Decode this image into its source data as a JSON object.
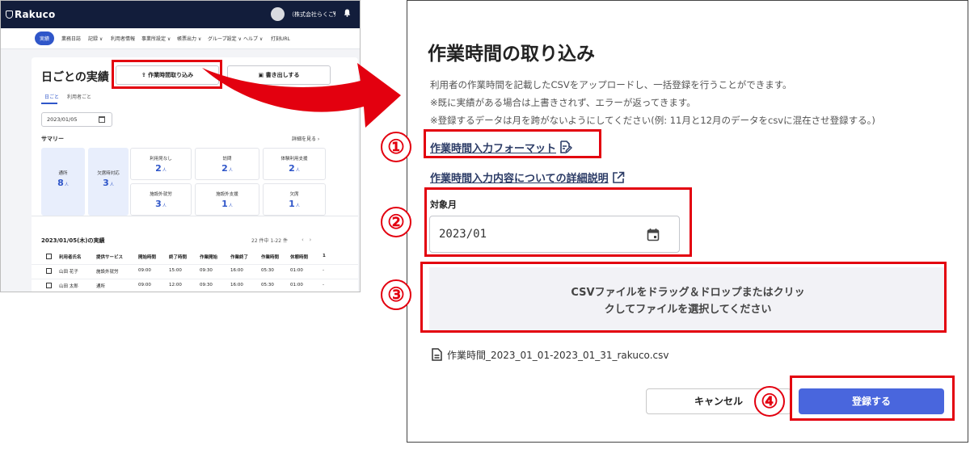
{
  "app": {
    "logo": "Rakuco",
    "company": "（株式会社らくこ）",
    "nav": [
      "実績",
      "業務日誌",
      "記録",
      "利用者情報",
      "事業所設定",
      "帳票出力",
      "グループ設定",
      "ヘルプ",
      "打刻URL"
    ],
    "page_title": "日ごとの実績",
    "import_button": "作業時間取り込み",
    "export_button": "書き出しする",
    "tabs": [
      "日ごと",
      "利用者ごと"
    ],
    "date": "2023/01/05",
    "summary_label": "サマリー",
    "details_link": "詳細を見る",
    "stats": [
      {
        "label": "通所",
        "value": "8",
        "unit": "人"
      },
      {
        "label": "欠席時対応",
        "value": "3",
        "unit": "人"
      },
      {
        "label": "利用見なし",
        "value": "2",
        "unit": "人"
      },
      {
        "label": "訪問",
        "value": "2",
        "unit": "人"
      },
      {
        "label": "体験利用支援",
        "value": "2",
        "unit": "人"
      },
      {
        "label": "施設外就労",
        "value": "3",
        "unit": "人"
      },
      {
        "label": "施設外支援",
        "value": "1",
        "unit": "人"
      },
      {
        "label": "欠席",
        "value": "1",
        "unit": "人"
      }
    ],
    "table_title": "2023/01/05(木)の実績",
    "pager": "22 件中 1-22 件",
    "columns": [
      "利用者氏名",
      "提供サービス",
      "開始時間",
      "終了時間",
      "作業開始",
      "作業終了",
      "作業時間",
      "休憩時間",
      "1"
    ],
    "rows": [
      [
        "山田 花子",
        "施設外就労",
        "09:00",
        "15:00",
        "09:30",
        "16:00",
        "05:30",
        "01:00",
        "-"
      ],
      [
        "山田 太郎",
        "通所",
        "09:00",
        "12:00",
        "09:30",
        "16:00",
        "05:30",
        "01:00",
        "-"
      ]
    ]
  },
  "dialog": {
    "title": "作業時間の取り込み",
    "description": [
      "利用者の作業時間を記載したCSVをアップロードし、一括登録を行うことができます。",
      "※既に実績がある場合は上書きされず、エラーが返ってきます。",
      "※登録するデータは月を跨がないようにしてください(例: 11月と12月のデータをcsvに混在させ登録する。)"
    ],
    "format_link": "作業時間入力フォーマット",
    "detail_link": "作業時間入力内容についての詳細説明",
    "month_label": "対象月",
    "month_value": "2023/01",
    "drop_text_1": "CSVファイルをドラッグ＆ドロップまたはクリッ",
    "drop_text_2": "クしてファイルを選択してください",
    "file_name": "作業時間_2023_01_01-2023_01_31_rakuco.csv",
    "cancel_label": "キャンセル",
    "submit_label": "登録する"
  },
  "markers": [
    "①",
    "②",
    "③",
    "④"
  ],
  "colors": {
    "highlight": "#e3000f",
    "primary": "#4966dd",
    "header": "#121d3b"
  }
}
